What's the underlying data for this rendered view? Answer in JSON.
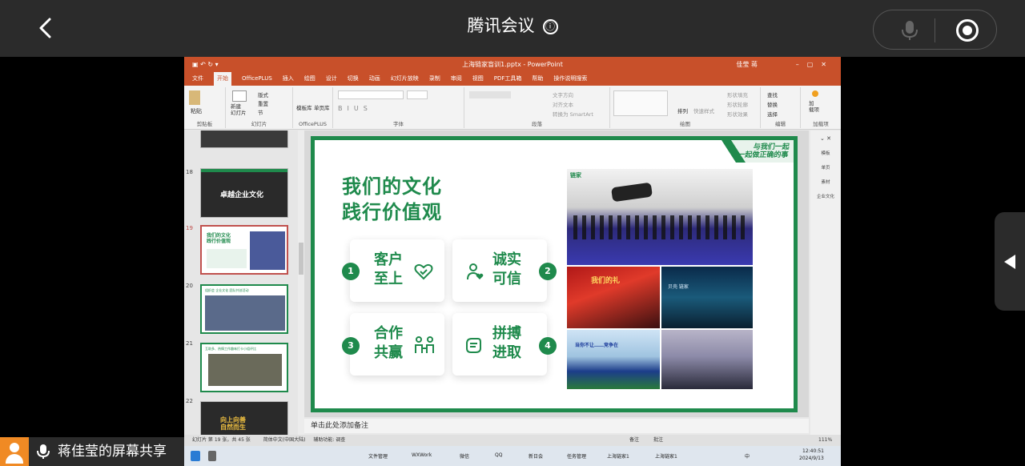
{
  "meeting": {
    "title": "腾讯会议",
    "info_icon": "ⓘ"
  },
  "ppt": {
    "window_title": "上海链家盲训1.pptx - PowerPoint",
    "user_name": "佳莹 蒋",
    "menu": [
      "文件",
      "开始",
      "OfficePLUS",
      "插入",
      "绘图",
      "设计",
      "切换",
      "动画",
      "幻灯片放映",
      "录制",
      "审阅",
      "视图",
      "PDF工具箱",
      "帮助",
      "操作说明搜索"
    ],
    "active_menu": "开始",
    "ribbon_groups": [
      "剪贴板",
      "幻灯片",
      "OfficePLUS",
      "字体",
      "段落",
      "绘图",
      "编辑",
      "加载项"
    ],
    "ribbon_labels": {
      "paste": "粘贴",
      "new_slide": "新建\n幻灯片",
      "layout": "版式",
      "reset": "重置",
      "section": "节",
      "template": "模板库",
      "single_page": "单页库",
      "find": "查找",
      "replace": "替换",
      "select": "选择",
      "addin": "加\n载项",
      "text_dir": "文字方向",
      "align_text": "对齐文本",
      "smartart": "转换为 SmartArt",
      "arrange": "排列",
      "quick_styles": "快速样式",
      "shape_fill": "形状填充",
      "shape_outline": "形状轮廓",
      "shape_effect": "形状效果"
    },
    "thumb_numbers": [
      "18",
      "19",
      "20",
      "21",
      "22"
    ],
    "thumb_texts": {
      "t18": "卓越企业文化",
      "t19": "我们的文化\n践行价值观",
      "t20": "组织会 企业文化 团队共创活动",
      "t21": "互助多、热情工作趣味打卡小组评比",
      "t22": "向上向善\n自然而生"
    },
    "slide": {
      "tag_line1": "与我们一起",
      "tag_line2": "一起做正确的事",
      "heading_line1": "我们的文化",
      "heading_line2": "践行价值观",
      "cards": [
        {
          "num": "1",
          "line1": "客户",
          "line2": "至上",
          "icon": "heart-handshake-icon"
        },
        {
          "num": "2",
          "line1": "诚实",
          "line2": "可信",
          "icon": "person-heart-icon"
        },
        {
          "num": "3",
          "line1": "合作",
          "line2": "共赢",
          "icon": "team-icon"
        },
        {
          "num": "4",
          "line1": "拼搏",
          "line2": "进取",
          "icon": "fist-icon"
        }
      ],
      "photo_captions": {
        "p1": "链家",
        "p2": "我们的礼",
        "p3": "贝壳 链家",
        "p4": "当你不让……竞争在",
        "p5": ""
      }
    },
    "notes_placeholder": "单击此处添加备注",
    "status": {
      "slide_info": "幻灯片 第 19 张，共 45 张",
      "language": "简体中文(中国大陆)",
      "accessibility": "辅助功能: 调查",
      "notes": "备注",
      "comments": "批注",
      "zoom": "111%"
    },
    "taskbar": {
      "items": [
        "文件管理",
        "WXWork",
        "微信",
        "QQ",
        "新日会",
        "任务管理",
        "上海链家1",
        "上海链家1"
      ],
      "time": "12:40:51",
      "date": "2024/9/13",
      "ime": "中"
    },
    "side_panel": [
      "模板",
      "单页",
      "素材",
      "企业文化"
    ]
  },
  "share_label": "蒋佳莹的屏幕共享",
  "colors": {
    "ppt_orange": "#c8502a",
    "slide_green": "#1f8a4c",
    "meeting_bar": "#2b2b2b",
    "avatar_orange": "#f08a24"
  }
}
